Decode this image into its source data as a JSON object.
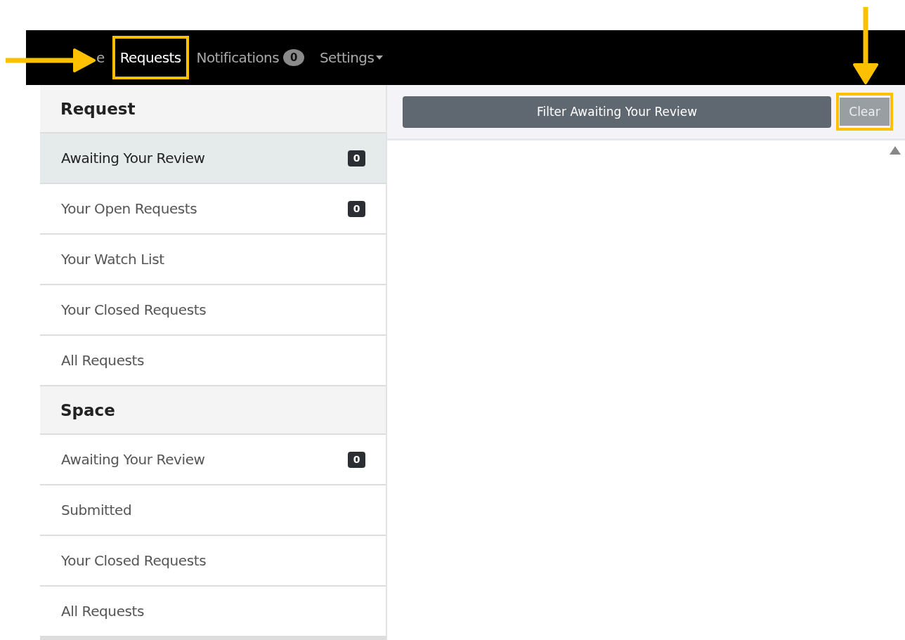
{
  "navbar": {
    "items": [
      {
        "fragments": [
          "e"
        ],
        "selected": false
      },
      {
        "label": "Requests",
        "selected": true,
        "highlighted": true
      },
      {
        "label": "Notifications",
        "selected": false,
        "badge": "0"
      },
      {
        "label": "Settings",
        "selected": false,
        "dropdown": true
      }
    ]
  },
  "sidebar": {
    "sections": [
      {
        "title": "Request",
        "items": [
          {
            "label": "Awaiting Your Review",
            "selected": true,
            "count": "0"
          },
          {
            "label": "Your Open Requests",
            "selected": false,
            "count": "0"
          },
          {
            "label": "Your Watch List",
            "selected": false
          },
          {
            "label": "Your Closed Requests",
            "selected": false
          },
          {
            "label": "All Requests",
            "selected": false
          }
        ]
      },
      {
        "title": "Space",
        "items": [
          {
            "label": "Awaiting Your Review",
            "selected": false,
            "count": "0"
          },
          {
            "label": "Submitted",
            "selected": false
          },
          {
            "label": "Your Closed Requests",
            "selected": false
          },
          {
            "label": "All Requests",
            "selected": false
          }
        ]
      }
    ]
  },
  "filter_bar": {
    "filter_button": "Filter Awaiting Your Review",
    "clear_button": "Clear",
    "clear_highlighted": true
  }
}
